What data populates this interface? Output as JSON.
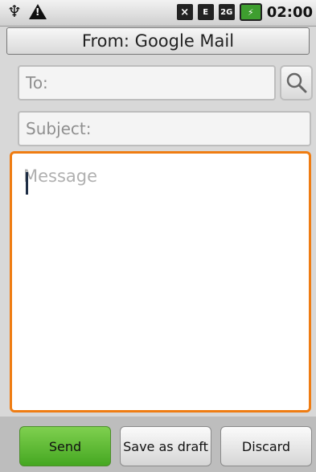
{
  "status_bar": {
    "time": "02:00",
    "icons": [
      "usb-icon",
      "warning-icon",
      "mute-icon",
      "network-icon",
      "signal-icon",
      "battery-icon"
    ],
    "network_label": "E",
    "signal_label": "2G"
  },
  "compose": {
    "from_label": "From: Google Mail",
    "to_placeholder": "To:",
    "subject_placeholder": "Subject:",
    "message_placeholder": "Message"
  },
  "actions": {
    "send_label": "Send",
    "save_draft_label": "Save as draft",
    "discard_label": "Discard"
  },
  "colors": {
    "focus_border": "#ef7c12",
    "send_button": "#5fbf35"
  }
}
